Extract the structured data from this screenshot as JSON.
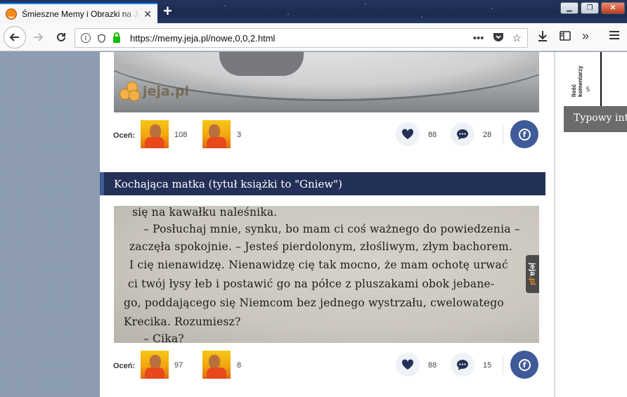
{
  "browser": {
    "tab_title": "Śmieszne Memy i Obrazki na Jeja.pl",
    "new_tab_label": "+",
    "url": "https://memy.jeja.pl/nowe,0,0,2.html",
    "window_controls": [
      "minimize",
      "restore",
      "close"
    ]
  },
  "posts": [
    {
      "image_watermark": "jeja.pl",
      "rating_label": "Oceń:",
      "likes": "108",
      "dislikes": "3",
      "hearts": "88",
      "comments": "28"
    },
    {
      "title": "Kochająca matka (tytuł książki to \"Gniew\")",
      "image_lines": [
        "się na kawałku naleśnika.",
        "– Posłuchaj mnie, synku, bo mam ci coś ważnego do powiedzenia –",
        "zaczęła spokojnie. – Jesteś pierdolonym, złośliwym, złym bachorem.",
        "I cię nienawidzę. Nienawidzę cię tak mocno, że mam ochotę urwać",
        "ci twój łysy łeb i postawić go na półce z pluszakami obok jebane-",
        "go, poddającego się Niemcom bez jednego wystrzału, cwelowatego",
        "Krecika. Rozumiesz?",
        "– Cika?"
      ],
      "image_tag_a": "jeja",
      "image_tag_b": ".pl",
      "rating_label": "Oceń:",
      "likes": "97",
      "dislikes": "8",
      "hearts": "88",
      "comments": "15"
    }
  ],
  "sidebar": {
    "chart_ylabel": "Ilość komentarzy",
    "chart_tick": "5",
    "banner": "Typowy internauta"
  },
  "icons": {
    "facebook": "f",
    "brand_color": "#233158",
    "facebook_color": "#3e5a98"
  }
}
